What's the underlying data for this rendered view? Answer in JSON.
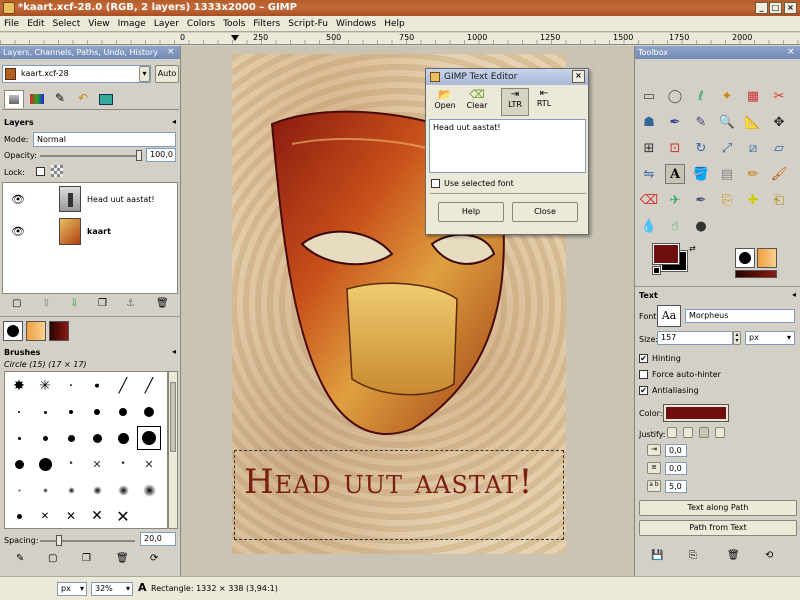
{
  "window": {
    "title": "*kaart.xcf-28.0 (RGB, 2 layers) 1333x2000 – GIMP"
  },
  "menu": [
    "File",
    "Edit",
    "Select",
    "View",
    "Image",
    "Layer",
    "Colors",
    "Tools",
    "Filters",
    "Script-Fu",
    "Windows",
    "Help"
  ],
  "ruler": [
    "0",
    "250",
    "500",
    "750",
    "1000",
    "1250",
    "1500",
    "1750",
    "2000"
  ],
  "layers_dock": {
    "title": "Layers, Channels, Paths, Undo, History",
    "image_select": "kaart.xcf-28",
    "auto_label": "Auto",
    "section": "Layers",
    "mode_label": "Mode:",
    "mode_value": "Normal",
    "opacity_label": "Opacity:",
    "opacity_value": "100,0",
    "lock_label": "Lock:",
    "layers": [
      {
        "name": "Head uut aastat!",
        "selected": false
      },
      {
        "name": "kaart",
        "selected": true
      }
    ]
  },
  "brushes": {
    "section": "Brushes",
    "current": "Circle (15) (17 × 17)",
    "spacing_label": "Spacing:",
    "spacing_value": "20,0"
  },
  "canvas": {
    "text": "Head uut aastat!"
  },
  "text_editor": {
    "title": "GIMP Text Editor",
    "open": "Open",
    "clear": "Clear",
    "ltr": "LTR",
    "rtl": "RTL",
    "content": "Head uut aastat!",
    "use_selected_font": "Use selected font",
    "help": "Help",
    "close": "Close"
  },
  "toolbox": {
    "title": "Toolbox",
    "section": "Text",
    "font_label": "Font:",
    "font_value": "Morpheus",
    "font_preview": "Aa",
    "size_label": "Size:",
    "size_value": "157",
    "size_unit": "px",
    "hinting": "Hinting",
    "force_autohinter": "Force auto-hinter",
    "antialiasing": "Antialiasing",
    "color_label": "Color:",
    "text_color": "#6e0e0e",
    "justify_label": "Justify:",
    "indent_value": "0,0",
    "line_spacing_value": "0,0",
    "letter_spacing_value": "5,0",
    "text_along_path": "Text along Path",
    "path_from_text": "Path from Text"
  },
  "status": {
    "unit": "px",
    "zoom": "32%",
    "message": "Rectangle: 1332 × 338  (3,94:1)"
  },
  "colors": {
    "accent": "#7189b5",
    "fg": "#6e0e0e",
    "bg": "#000000",
    "canvas_text": "#7a1e12"
  }
}
